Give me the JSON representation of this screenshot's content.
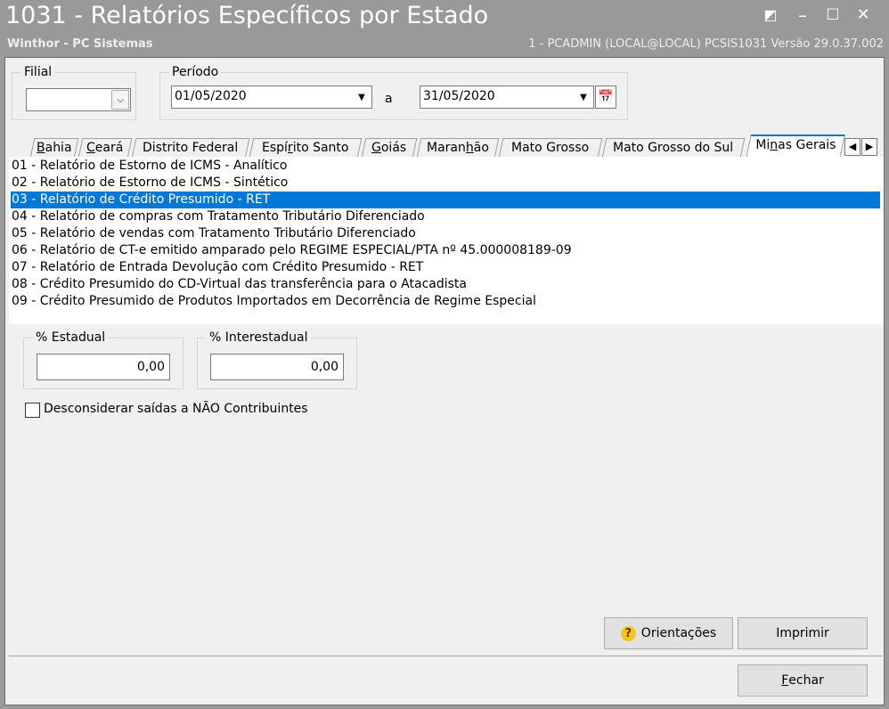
{
  "window": {
    "title": "1031 - Relatórios Específicos por Estado",
    "subtitle_left": "Winthor - PC Sistemas",
    "subtitle_right": "1 - PCADMIN (LOCAL@LOCAL)   PCSIS1031  Versão  29.0.37.002",
    "controls": {
      "menu": "◩",
      "minimize": "–",
      "maximize": "☐",
      "close": "✕"
    }
  },
  "filial": {
    "legend": "Filial",
    "value": "",
    "dropdown_glyph": "⌵"
  },
  "periodo": {
    "legend": "Período",
    "start": "01/05/2020",
    "separator": "a",
    "end": "31/05/2020",
    "dropdown_glyph": "▼",
    "calendar_icon": "📅"
  },
  "tabs": [
    {
      "label": "Bahia",
      "underline": "B",
      "rest": "ahia"
    },
    {
      "label": "Ceará",
      "underline": "C",
      "rest": "eará"
    },
    {
      "label": "Distrito Federal"
    },
    {
      "label": "Espírito Santo",
      "pre": "Espí",
      "underline": "r",
      "rest": "ito Santo"
    },
    {
      "label": "Goiás",
      "underline": "G",
      "rest": "oiás"
    },
    {
      "label": "Maranhão",
      "pre": "Maran",
      "underline": "h",
      "rest": "ão"
    },
    {
      "label": "Mato Grosso"
    },
    {
      "label": "Mato Grosso do Sul"
    },
    {
      "label": "Minas Gerais",
      "pre": "Mi",
      "underline": "n",
      "rest": "as Gerais"
    }
  ],
  "tab_scroll": {
    "left": "◀",
    "right": "▶"
  },
  "reports": [
    "01 - Relatório de Estorno de ICMS - Analítico",
    "02 - Relatório de Estorno de ICMS - Sintético",
    "03 - Relatório de Crédito Presumido - RET",
    "04 - Relatório de compras com Tratamento Tributário Diferenciado",
    "05 - Relatório de vendas com Tratamento Tributário Diferenciado",
    "06 - Relatório de CT-e emitido amparado pelo REGIME ESPECIAL/PTA nº 45.000008189-09",
    "07 - Relatório de Entrada Devolução com Crédito Presumido - RET",
    "08 - Crédito Presumido do CD-Virtual das transferência para o Atacadista",
    "09 - Crédito Presumido de Produtos Importados em Decorrência de Regime Especial"
  ],
  "selected_report_index": 2,
  "estadual": {
    "legend": "% Estadual",
    "value": "0,00"
  },
  "interestadual": {
    "legend": "% Interestadual",
    "value": "0,00"
  },
  "checkbox": {
    "label": "Desconsiderar saídas a NÃO Contribuintes",
    "checked": false
  },
  "buttons": {
    "orientacoes": "Orientações",
    "imprimir": "Imprimir",
    "fechar_underline": "F",
    "fechar_rest": "echar",
    "help_glyph": "?"
  },
  "colors": {
    "selection": "#0078d7",
    "titlebar": "#999999",
    "active_tab_accent": "#1a6fc9"
  }
}
